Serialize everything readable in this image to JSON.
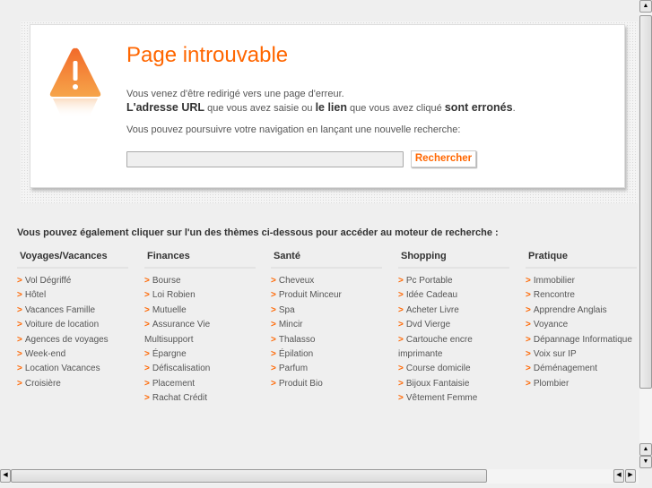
{
  "error": {
    "title": "Page introuvable",
    "line1": "Vous venez d'être redirigé vers une page d'erreur.",
    "line2_bold1": "L'adresse URL",
    "line2_text1": " que vous avez saisie ou ",
    "line2_bold2": "le lien",
    "line2_text2": " que vous avez cliqué ",
    "line2_bold3": "sont erronés",
    "line2_end": ".",
    "line3": "Vous pouvez poursuivre votre navigation en lançant une nouvelle recherche:",
    "search_value": "",
    "search_button": "Rechercher"
  },
  "themes": {
    "intro": "Vous pouvez également cliquer sur l'un des thèmes ci-dessous pour accéder au moteur de recherche :",
    "columns": [
      {
        "title": "Voyages/Vacances",
        "items": [
          "Vol Dégriffé",
          "Hôtel",
          "Vacances Famille",
          "Voiture de location",
          "Agences de voyages",
          "Week-end",
          "Location Vacances",
          "Croisière"
        ]
      },
      {
        "title": "Finances",
        "items": [
          "Bourse",
          "Loi Robien",
          "Mutuelle",
          "Assurance Vie Multisupport",
          "Épargne",
          "Défiscalisation",
          "Placement",
          "Rachat Crédit"
        ]
      },
      {
        "title": "Santé",
        "items": [
          "Cheveux",
          "Produit Minceur",
          "Spa",
          "Mincir",
          "Thalasso",
          "Épilation",
          "Parfum",
          "Produit Bio"
        ]
      },
      {
        "title": "Shopping",
        "items": [
          "Pc Portable",
          "Idée Cadeau",
          "Acheter Livre",
          "Dvd Vierge",
          "Cartouche encre imprimante",
          "Course domicile",
          "Bijoux Fantaisie",
          "Vêtement Femme"
        ]
      },
      {
        "title": "Pratique",
        "items": [
          "Immobilier",
          "Rencontre",
          "Apprendre Anglais",
          "Voyance",
          "Dépannage Informatique",
          "Voix sur IP",
          "Déménagement",
          "Plombier"
        ]
      }
    ],
    "arrow": ">"
  },
  "colors": {
    "accent": "#ff6600"
  }
}
